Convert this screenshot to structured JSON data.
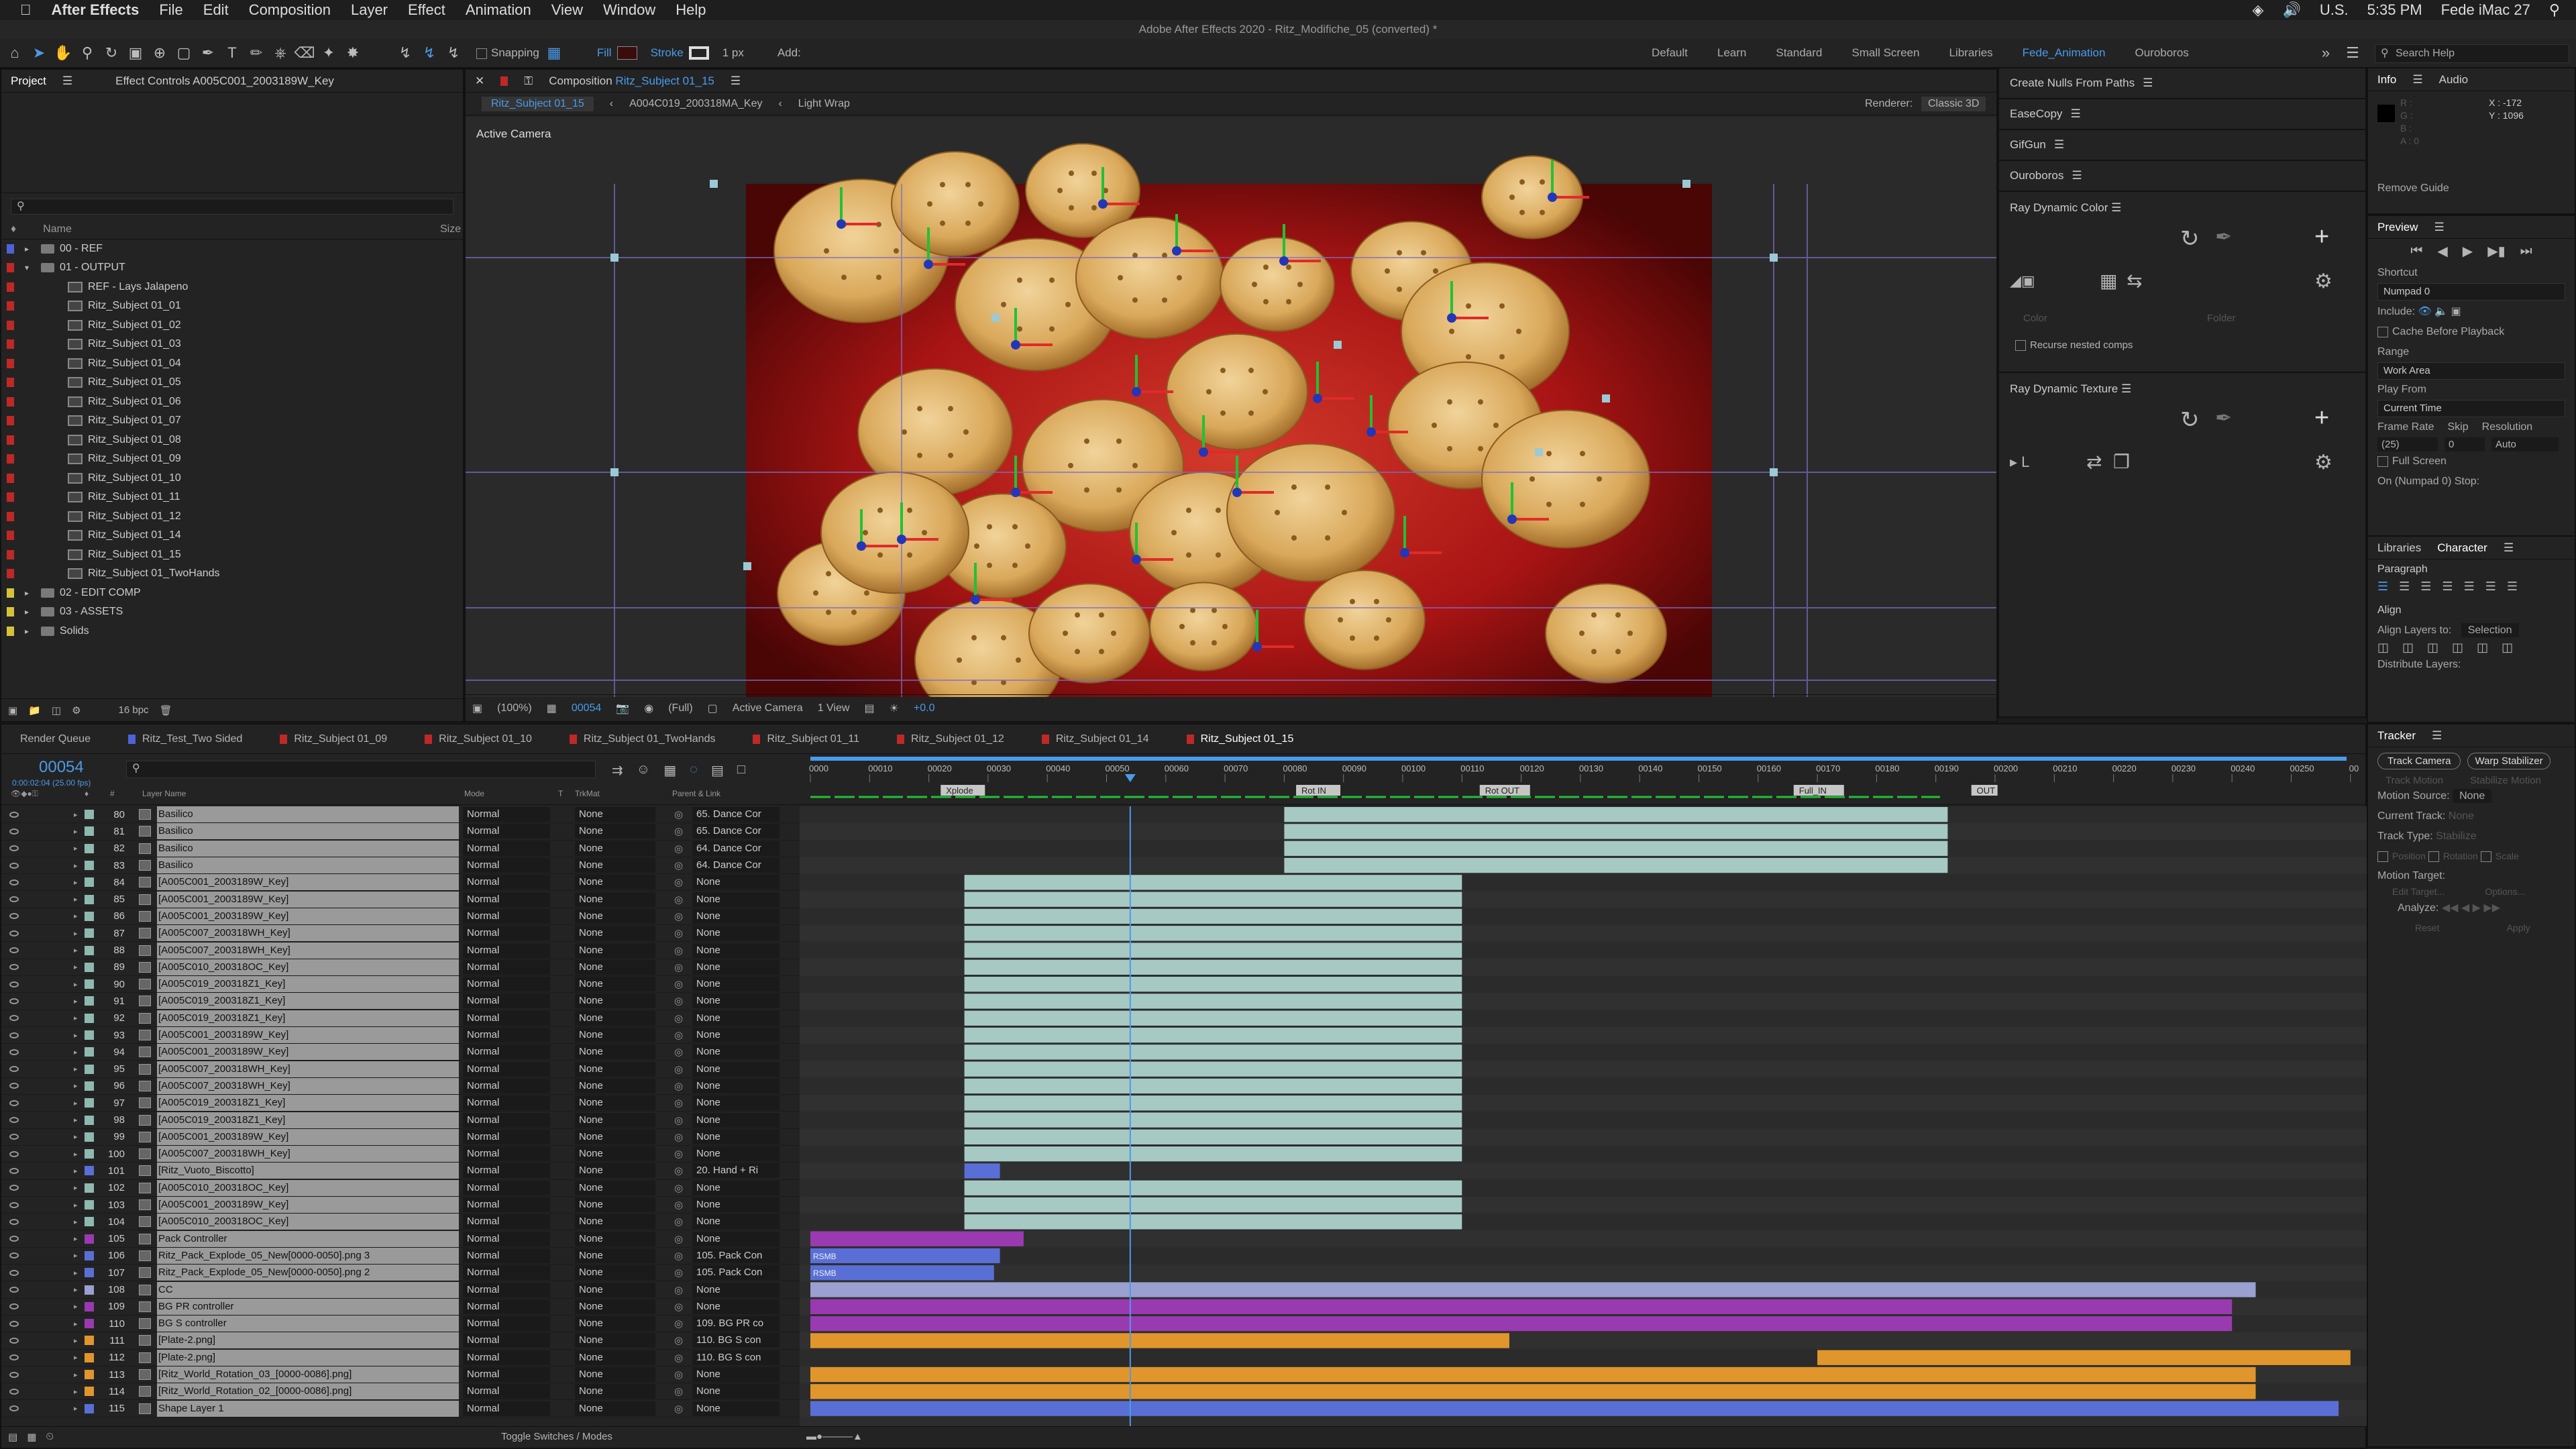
{
  "menubar": {
    "app": "After Effects",
    "items": [
      "File",
      "Edit",
      "Composition",
      "Layer",
      "Effect",
      "Animation",
      "View",
      "Window",
      "Help"
    ],
    "locale": "U.S.",
    "clock": "5:35 PM",
    "user": "Fede iMac 27"
  },
  "window_title": "Adobe After Effects 2020 - Ritz_Modifiche_05 (converted) *",
  "toolbar": {
    "snapping": "Snapping",
    "fill": "Fill",
    "stroke": "Stroke",
    "stroke_width": "1 px",
    "add": "Add:",
    "workspaces": [
      "Default",
      "Learn",
      "Standard",
      "Small Screen",
      "Libraries",
      "Fede_Animation",
      "Ouroboros"
    ],
    "active_workspace": "Fede_Animation",
    "search_placeholder": "Search Help"
  },
  "project": {
    "tab": "Project",
    "tab2": "Effect Controls A005C001_2003189W_Key",
    "col_name": "Name",
    "col_size": "Size",
    "bpc": "16 bpc",
    "items": [
      {
        "label": "00 - REF",
        "type": "folder",
        "indent": 0,
        "color": "#4e62d6",
        "open": false
      },
      {
        "label": "01 - OUTPUT",
        "type": "folder",
        "indent": 0,
        "color": "#c02828",
        "open": true
      },
      {
        "label": "REF - Lays Jalapeno",
        "type": "comp",
        "indent": 1,
        "color": "#c02828"
      },
      {
        "label": "Ritz_Subject 01_01",
        "type": "comp",
        "indent": 1,
        "color": "#c02828"
      },
      {
        "label": "Ritz_Subject 01_02",
        "type": "comp",
        "indent": 1,
        "color": "#c02828"
      },
      {
        "label": "Ritz_Subject 01_03",
        "type": "comp",
        "indent": 1,
        "color": "#c02828"
      },
      {
        "label": "Ritz_Subject 01_04",
        "type": "comp",
        "indent": 1,
        "color": "#c02828"
      },
      {
        "label": "Ritz_Subject 01_05",
        "type": "comp",
        "indent": 1,
        "color": "#c02828"
      },
      {
        "label": "Ritz_Subject 01_06",
        "type": "comp",
        "indent": 1,
        "color": "#c02828"
      },
      {
        "label": "Ritz_Subject 01_07",
        "type": "comp",
        "indent": 1,
        "color": "#c02828"
      },
      {
        "label": "Ritz_Subject 01_08",
        "type": "comp",
        "indent": 1,
        "color": "#c02828"
      },
      {
        "label": "Ritz_Subject 01_09",
        "type": "comp",
        "indent": 1,
        "color": "#c02828"
      },
      {
        "label": "Ritz_Subject 01_10",
        "type": "comp",
        "indent": 1,
        "color": "#c02828"
      },
      {
        "label": "Ritz_Subject 01_11",
        "type": "comp",
        "indent": 1,
        "color": "#c02828"
      },
      {
        "label": "Ritz_Subject 01_12",
        "type": "comp",
        "indent": 1,
        "color": "#c02828"
      },
      {
        "label": "Ritz_Subject 01_14",
        "type": "comp",
        "indent": 1,
        "color": "#c02828"
      },
      {
        "label": "Ritz_Subject 01_15",
        "type": "comp",
        "indent": 1,
        "color": "#c02828"
      },
      {
        "label": "Ritz_Subject 01_TwoHands",
        "type": "comp",
        "indent": 1,
        "color": "#c02828"
      },
      {
        "label": "02 - EDIT COMP",
        "type": "folder",
        "indent": 0,
        "color": "#d6c23a",
        "open": false
      },
      {
        "label": "03 - ASSETS",
        "type": "folder",
        "indent": 0,
        "color": "#d6c23a",
        "open": false
      },
      {
        "label": "Solids",
        "type": "folder",
        "indent": 0,
        "color": "#d6c23a",
        "open": false
      }
    ]
  },
  "composition": {
    "tab_prefix": "Composition",
    "tab_name": "Ritz_Subject 01_15",
    "crumbs": [
      "Ritz_Subject 01_15",
      "A004C019_200318MA_Key",
      "Light Wrap"
    ],
    "renderer_label": "Renderer:",
    "renderer": "Classic 3D",
    "camera_label": "Active Camera",
    "footer": {
      "zoom": "(100%)",
      "frame": "00054",
      "quality": "(Full)",
      "camera": "Active Camera",
      "views": "1 View",
      "exposure": "+0.0"
    }
  },
  "effects": [
    {
      "name": "Create Nulls From Paths"
    },
    {
      "name": "EaseCopy"
    },
    {
      "name": "GifGun"
    },
    {
      "name": "Ouroboros"
    },
    {
      "name": "Ray Dynamic Color",
      "color_label": "Color",
      "folder_label": "Folder",
      "recurse": "Recurse nested comps"
    },
    {
      "name": "Ray Dynamic Texture"
    }
  ],
  "info": {
    "tab": "Info",
    "tab2": "Audio",
    "r": "R :",
    "g": "G :",
    "b": "B :",
    "a": "A : 0",
    "x": "X : -172",
    "y": "Y : 1096",
    "remove_guide": "Remove Guide"
  },
  "preview": {
    "title": "Preview",
    "shortcut_label": "Shortcut",
    "shortcut": "Numpad 0",
    "include": "Include:",
    "cache": "Cache Before Playback",
    "range_label": "Range",
    "range": "Work Area",
    "play_from_label": "Play From",
    "play_from": "Current Time",
    "frame_rate_label": "Frame Rate",
    "skip_label": "Skip",
    "resolution_label": "Resolution",
    "frame_rate": "(25)",
    "skip": "0",
    "resolution": "Auto",
    "full_screen": "Full Screen",
    "stop": "On (Numpad 0) Stop:"
  },
  "character": {
    "tab": "Libraries",
    "tab2": "Character",
    "paragraph": "Paragraph",
    "align": "Align",
    "align_to_label": "Align Layers to:",
    "align_to": "Selection",
    "distribute": "Distribute Layers:"
  },
  "tracker": {
    "title": "Tracker",
    "track_camera": "Track Camera",
    "warp": "Warp Stabilizer",
    "track_motion": "Track Motion",
    "stabilize": "Stabilize Motion",
    "motion_source_label": "Motion Source:",
    "motion_source": "None",
    "current_track_label": "Current Track:",
    "current_track": "None",
    "track_type_label": "Track Type:",
    "track_type": "Stabilize",
    "position": "Position",
    "rotation": "Rotation",
    "scale": "Scale",
    "motion_target": "Motion Target:",
    "edit_target": "Edit Target...",
    "options": "Options...",
    "analyze": "Analyze:",
    "reset": "Reset",
    "apply": "Apply"
  },
  "timeline": {
    "tabs": [
      {
        "label": "Render Queue",
        "color": ""
      },
      {
        "label": "Ritz_Test_Two Sided",
        "color": "#4e62d6"
      },
      {
        "label": "Ritz_Subject 01_09",
        "color": "#c02828"
      },
      {
        "label": "Ritz_Subject 01_10",
        "color": "#c02828"
      },
      {
        "label": "Ritz_Subject 01_TwoHands",
        "color": "#c02828"
      },
      {
        "label": "Ritz_Subject 01_11",
        "color": "#c02828"
      },
      {
        "label": "Ritz_Subject 01_12",
        "color": "#c02828"
      },
      {
        "label": "Ritz_Subject 01_14",
        "color": "#c02828"
      },
      {
        "label": "Ritz_Subject 01_15",
        "color": "#c02828"
      }
    ],
    "timecode": "00054",
    "timecode_sub": "0:00:02:04 (25.00 fps)",
    "col_layer": "Layer Name",
    "col_mode": "Mode",
    "col_t": "T",
    "col_trkmat": "TrkMat",
    "col_parent": "Parent & Link",
    "ruler": [
      "0000",
      "00010",
      "00020",
      "00030",
      "00040",
      "00050",
      "00060",
      "00070",
      "00080",
      "00090",
      "00100",
      "00110",
      "00120",
      "00130",
      "00140",
      "00150",
      "00160",
      "00170",
      "00180",
      "00190",
      "00200",
      "00210",
      "00220",
      "00230",
      "00240",
      "00250",
      "00"
    ],
    "markers": [
      {
        "label": "Xplode",
        "frame": 22
      },
      {
        "label": "Rot IN",
        "frame": 82
      },
      {
        "label": "Rot OUT",
        "frame": 113
      },
      {
        "label": "Full_IN",
        "frame": 166
      },
      {
        "label": "OUT",
        "frame": 196
      }
    ],
    "current_frame": 54,
    "footer": "Toggle Switches / Modes",
    "layers": [
      {
        "n": "80",
        "name": "Basilico",
        "mode": "Normal",
        "trk": "None",
        "parent": "65. Dance Cor",
        "color": "#8fb8b0",
        "start": 80,
        "end": 192,
        "bar": "#a7c9c4"
      },
      {
        "n": "81",
        "name": "Basilico",
        "mode": "Normal",
        "trk": "None",
        "parent": "65. Dance Cor",
        "color": "#8fb8b0",
        "start": 80,
        "end": 192,
        "bar": "#a7c9c4"
      },
      {
        "n": "82",
        "name": "Basilico",
        "mode": "Normal",
        "trk": "None",
        "parent": "64. Dance Cor",
        "color": "#8fb8b0",
        "start": 80,
        "end": 192,
        "bar": "#a7c9c4"
      },
      {
        "n": "83",
        "name": "Basilico",
        "mode": "Normal",
        "trk": "None",
        "parent": "64. Dance Cor",
        "color": "#8fb8b0",
        "start": 80,
        "end": 192,
        "bar": "#a7c9c4"
      },
      {
        "n": "84",
        "name": "[A005C001_2003189W_Key]",
        "mode": "Normal",
        "trk": "None",
        "parent": "None",
        "color": "#8fb8b0",
        "start": 26,
        "end": 110,
        "bar": "#a7c9c4"
      },
      {
        "n": "85",
        "name": "[A005C001_2003189W_Key]",
        "mode": "Normal",
        "trk": "None",
        "parent": "None",
        "color": "#8fb8b0",
        "start": 26,
        "end": 110,
        "bar": "#a7c9c4"
      },
      {
        "n": "86",
        "name": "[A005C001_2003189W_Key]",
        "mode": "Normal",
        "trk": "None",
        "parent": "None",
        "color": "#8fb8b0",
        "start": 26,
        "end": 110,
        "bar": "#a7c9c4"
      },
      {
        "n": "87",
        "name": "[A005C007_200318WH_Key]",
        "mode": "Normal",
        "trk": "None",
        "parent": "None",
        "color": "#8fb8b0",
        "start": 26,
        "end": 110,
        "bar": "#a7c9c4"
      },
      {
        "n": "88",
        "name": "[A005C007_200318WH_Key]",
        "mode": "Normal",
        "trk": "None",
        "parent": "None",
        "color": "#8fb8b0",
        "start": 26,
        "end": 110,
        "bar": "#a7c9c4"
      },
      {
        "n": "89",
        "name": "[A005C010_200318OC_Key]",
        "mode": "Normal",
        "trk": "None",
        "parent": "None",
        "color": "#8fb8b0",
        "start": 26,
        "end": 110,
        "bar": "#a7c9c4"
      },
      {
        "n": "90",
        "name": "[A005C019_200318Z1_Key]",
        "mode": "Normal",
        "trk": "None",
        "parent": "None",
        "color": "#8fb8b0",
        "start": 26,
        "end": 110,
        "bar": "#a7c9c4"
      },
      {
        "n": "91",
        "name": "[A005C019_200318Z1_Key]",
        "mode": "Normal",
        "trk": "None",
        "parent": "None",
        "color": "#8fb8b0",
        "start": 26,
        "end": 110,
        "bar": "#a7c9c4"
      },
      {
        "n": "92",
        "name": "[A005C019_200318Z1_Key]",
        "mode": "Normal",
        "trk": "None",
        "parent": "None",
        "color": "#8fb8b0",
        "start": 26,
        "end": 110,
        "bar": "#a7c9c4"
      },
      {
        "n": "93",
        "name": "[A005C001_2003189W_Key]",
        "mode": "Normal",
        "trk": "None",
        "parent": "None",
        "color": "#8fb8b0",
        "start": 26,
        "end": 110,
        "bar": "#a7c9c4"
      },
      {
        "n": "94",
        "name": "[A005C001_2003189W_Key]",
        "mode": "Normal",
        "trk": "None",
        "parent": "None",
        "color": "#8fb8b0",
        "start": 26,
        "end": 110,
        "bar": "#a7c9c4"
      },
      {
        "n": "95",
        "name": "[A005C007_200318WH_Key]",
        "mode": "Normal",
        "trk": "None",
        "parent": "None",
        "color": "#8fb8b0",
        "start": 26,
        "end": 110,
        "bar": "#a7c9c4"
      },
      {
        "n": "96",
        "name": "[A005C007_200318WH_Key]",
        "mode": "Normal",
        "trk": "None",
        "parent": "None",
        "color": "#8fb8b0",
        "start": 26,
        "end": 110,
        "bar": "#a7c9c4"
      },
      {
        "n": "97",
        "name": "[A005C019_200318Z1_Key]",
        "mode": "Normal",
        "trk": "None",
        "parent": "None",
        "color": "#8fb8b0",
        "start": 26,
        "end": 110,
        "bar": "#a7c9c4"
      },
      {
        "n": "98",
        "name": "[A005C019_200318Z1_Key]",
        "mode": "Normal",
        "trk": "None",
        "parent": "None",
        "color": "#8fb8b0",
        "start": 26,
        "end": 110,
        "bar": "#a7c9c4"
      },
      {
        "n": "99",
        "name": "[A005C001_2003189W_Key]",
        "mode": "Normal",
        "trk": "None",
        "parent": "None",
        "color": "#8fb8b0",
        "start": 26,
        "end": 110,
        "bar": "#a7c9c4"
      },
      {
        "n": "100",
        "name": "[A005C007_200318WH_Key]",
        "mode": "Normal",
        "trk": "None",
        "parent": "None",
        "color": "#8fb8b0",
        "start": 26,
        "end": 110,
        "bar": "#a7c9c4"
      },
      {
        "n": "101",
        "name": "[Ritz_Vuoto_Biscotto]",
        "mode": "Normal",
        "trk": "None",
        "parent": "20. Hand + Ri",
        "color": "#5a6fd6",
        "start": 26,
        "end": 32,
        "bar": "#5a6fd6"
      },
      {
        "n": "102",
        "name": "[A005C010_200318OC_Key]",
        "mode": "Normal",
        "trk": "None",
        "parent": "None",
        "color": "#8fb8b0",
        "start": 26,
        "end": 110,
        "bar": "#a7c9c4"
      },
      {
        "n": "103",
        "name": "[A005C001_2003189W_Key]",
        "mode": "Normal",
        "trk": "None",
        "parent": "None",
        "color": "#8fb8b0",
        "start": 26,
        "end": 110,
        "bar": "#a7c9c4"
      },
      {
        "n": "104",
        "name": "[A005C010_200318OC_Key]",
        "mode": "Normal",
        "trk": "None",
        "parent": "None",
        "color": "#8fb8b0",
        "start": 26,
        "end": 110,
        "bar": "#a7c9c4"
      },
      {
        "n": "105",
        "name": "Pack Controller",
        "mode": "Normal",
        "trk": "None",
        "parent": "None",
        "color": "#9a3ab0",
        "start": 0,
        "end": 36,
        "bar": "#9a3ab0"
      },
      {
        "n": "106",
        "name": "Ritz_Pack_Explode_05_New[0000-0050].png 3",
        "mode": "Normal",
        "trk": "None",
        "parent": "105. Pack Con",
        "color": "#5a6fd6",
        "start": 0,
        "end": 32,
        "bar": "#5a6fd6",
        "tag": "RSMB"
      },
      {
        "n": "107",
        "name": "Ritz_Pack_Explode_05_New[0000-0050].png 2",
        "mode": "Normal",
        "trk": "None",
        "parent": "105. Pack Con",
        "color": "#5a6fd6",
        "start": 0,
        "end": 31,
        "bar": "#5a6fd6",
        "tag": "RSMB"
      },
      {
        "n": "108",
        "name": "CC",
        "mode": "Normal",
        "trk": "None",
        "parent": "None",
        "color": "#9aa0d0",
        "start": 0,
        "end": 244,
        "bar": "#9aa0d0"
      },
      {
        "n": "109",
        "name": "BG PR controller",
        "mode": "Normal",
        "trk": "None",
        "parent": "None",
        "color": "#9a3ab0",
        "start": 0,
        "end": 240,
        "bar": "#9a3ab0"
      },
      {
        "n": "110",
        "name": "BG S controller",
        "mode": "Normal",
        "trk": "None",
        "parent": "109. BG PR co",
        "color": "#9a3ab0",
        "start": 0,
        "end": 240,
        "bar": "#9a3ab0"
      },
      {
        "n": "111",
        "name": "[Plate-2.png]",
        "mode": "Normal",
        "trk": "None",
        "parent": "110. BG S con",
        "color": "#e0962c",
        "start": 0,
        "end": 118,
        "bar": "#e0962c"
      },
      {
        "n": "112",
        "name": "[Plate-2.png]",
        "mode": "Normal",
        "trk": "None",
        "parent": "110. BG S con",
        "color": "#e0962c",
        "start": 170,
        "end": 260,
        "bar": "#e0962c"
      },
      {
        "n": "113",
        "name": "[Ritz_World_Rotation_03_[0000-0086].png]",
        "mode": "Normal",
        "trk": "None",
        "parent": "None",
        "color": "#e0962c",
        "start": 0,
        "end": 244,
        "bar": "#e0962c"
      },
      {
        "n": "114",
        "name": "[Ritz_World_Rotation_02_[0000-0086].png]",
        "mode": "Normal",
        "trk": "None",
        "parent": "None",
        "color": "#e0962c",
        "start": 0,
        "end": 244,
        "bar": "#e0962c"
      },
      {
        "n": "115",
        "name": "Shape Layer 1",
        "mode": "Normal",
        "trk": "None",
        "parent": "None",
        "color": "#5a6fd6",
        "start": 0,
        "end": 258,
        "bar": "#5a6fd6"
      }
    ]
  }
}
